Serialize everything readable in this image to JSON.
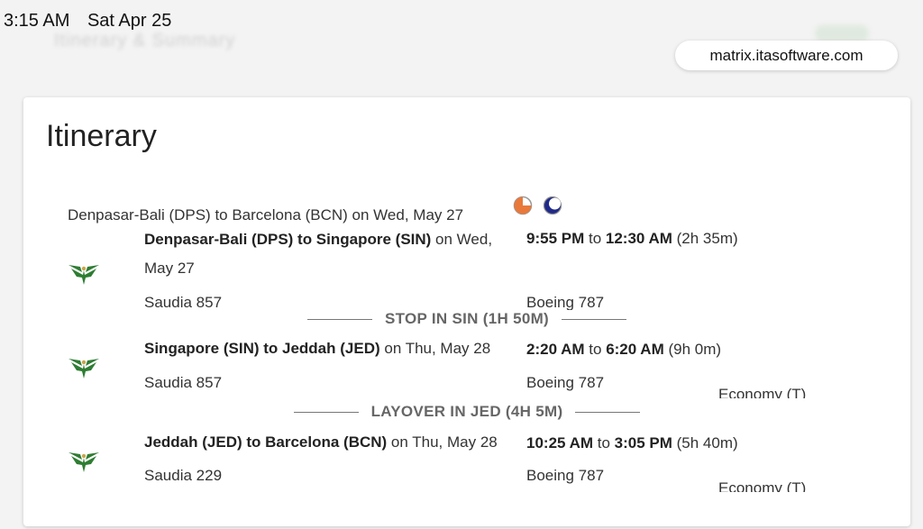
{
  "status": {
    "time": "3:15 AM",
    "date": "Sat Apr 25"
  },
  "background_hint": {
    "text": "Itinerary & Summary"
  },
  "browser": {
    "url": "matrix.itasoftware.com"
  },
  "itinerary": {
    "title": "Itinerary",
    "route_summary": "Denpasar-Bali (DPS) to Barcelona (BCN) on Wed, May 27",
    "tz_icons": [
      "sunset-icon",
      "moon-icon"
    ],
    "colors": {
      "sunset": "#e8793a",
      "moon": "#1f2a8a",
      "logo": "#2e7d32"
    },
    "segments": [
      {
        "route": "Denpasar-Bali (DPS) to Singapore (SIN)",
        "date": " on Wed, May 27",
        "depart": "9:55 PM",
        "to": " to ",
        "arrive": "12:30 AM",
        "duration": " (2h 35m)",
        "flight": "Saudia 857",
        "aircraft": "Boeing 787",
        "cabin": ""
      },
      {
        "route": "Singapore (SIN) to Jeddah (JED)",
        "date": " on Thu, May 28",
        "depart": "2:20 AM",
        "to": " to ",
        "arrive": "6:20 AM",
        "duration": " (9h 0m)",
        "flight": "Saudia 857",
        "aircraft": "Boeing 787",
        "cabin": "Economy (T)"
      },
      {
        "route": "Jeddah (JED) to Barcelona (BCN)",
        "date": " on Thu, May 28",
        "depart": "10:25 AM",
        "to": " to ",
        "arrive": "3:05 PM",
        "duration": " (5h 40m)",
        "flight": "Saudia 229",
        "aircraft": "Boeing 787",
        "cabin": "Economy (T)"
      }
    ],
    "connections": [
      {
        "label": "STOP IN SIN (1H 50M)"
      },
      {
        "label": "LAYOVER IN JED (4H 5M)"
      }
    ]
  }
}
